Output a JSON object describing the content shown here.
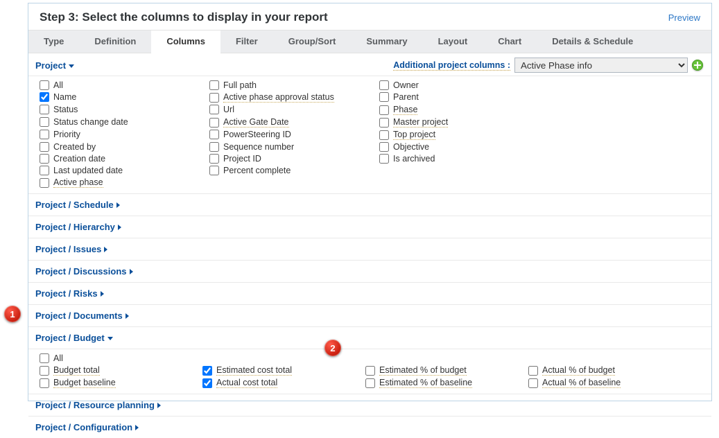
{
  "header": {
    "title": "Step 3: Select the columns to display in your report",
    "preview": "Preview"
  },
  "tabs": [
    {
      "label": "Type"
    },
    {
      "label": "Definition"
    },
    {
      "label": "Columns"
    },
    {
      "label": "Filter"
    },
    {
      "label": "Group/Sort"
    },
    {
      "label": "Summary"
    },
    {
      "label": "Layout"
    },
    {
      "label": "Chart"
    },
    {
      "label": "Details & Schedule"
    }
  ],
  "active_tab_index": 2,
  "project_toggle": "Project",
  "additional": {
    "label": "Additional project columns :",
    "selected": "Active Phase info"
  },
  "proj_cols": {
    "col1": [
      {
        "label": "All",
        "checked": false
      },
      {
        "label": "Name",
        "checked": true
      },
      {
        "label": "Status",
        "checked": false
      },
      {
        "label": "Status change date",
        "checked": false
      },
      {
        "label": "Priority",
        "checked": false
      },
      {
        "label": "Created by",
        "checked": false
      },
      {
        "label": "Creation date",
        "checked": false
      },
      {
        "label": "Last updated date",
        "checked": false
      },
      {
        "label": "Active phase",
        "checked": false,
        "und": true
      }
    ],
    "col2": [
      {
        "label": "Full path",
        "checked": false
      },
      {
        "label": "Active phase approval status",
        "checked": false,
        "und": true
      },
      {
        "label": "Url",
        "checked": false
      },
      {
        "label": "Active Gate Date",
        "checked": false,
        "und": true
      },
      {
        "label": "PowerSteering ID",
        "checked": false
      },
      {
        "label": "Sequence number",
        "checked": false
      },
      {
        "label": "Project ID",
        "checked": false
      },
      {
        "label": "Percent complete",
        "checked": false
      }
    ],
    "col3": [
      {
        "label": "Owner",
        "checked": false
      },
      {
        "label": "Parent",
        "checked": false
      },
      {
        "label": "Phase",
        "checked": false,
        "und": true
      },
      {
        "label": "Master project",
        "checked": false,
        "und": true
      },
      {
        "label": "Top project",
        "checked": false,
        "und": true
      },
      {
        "label": "Objective",
        "checked": false
      },
      {
        "label": "Is archived",
        "checked": false
      }
    ]
  },
  "collapsed": [
    "Project / Schedule",
    "Project / Hierarchy",
    "Project / Issues",
    "Project / Discussions",
    "Project / Risks",
    "Project / Documents"
  ],
  "budget_title": "Project / Budget",
  "budget": {
    "c1": [
      {
        "label": "All",
        "checked": false
      },
      {
        "label": "Budget total",
        "checked": false,
        "und": true
      },
      {
        "label": "Budget baseline",
        "checked": false,
        "und": true
      }
    ],
    "c2": [
      {
        "label": "Estimated cost total",
        "checked": true,
        "und": true
      },
      {
        "label": "Actual cost total",
        "checked": true,
        "und": true
      }
    ],
    "c3": [
      {
        "label": "Estimated % of budget",
        "checked": false,
        "und": true
      },
      {
        "label": "Estimated % of baseline",
        "checked": false,
        "und": true
      }
    ],
    "c4": [
      {
        "label": "Actual % of budget",
        "checked": false,
        "und": true
      },
      {
        "label": "Actual % of baseline",
        "checked": false,
        "und": true
      }
    ]
  },
  "collapsed2": [
    "Project / Resource planning",
    "Project / Configuration"
  ],
  "badges": {
    "b1": "1",
    "b2": "2"
  }
}
